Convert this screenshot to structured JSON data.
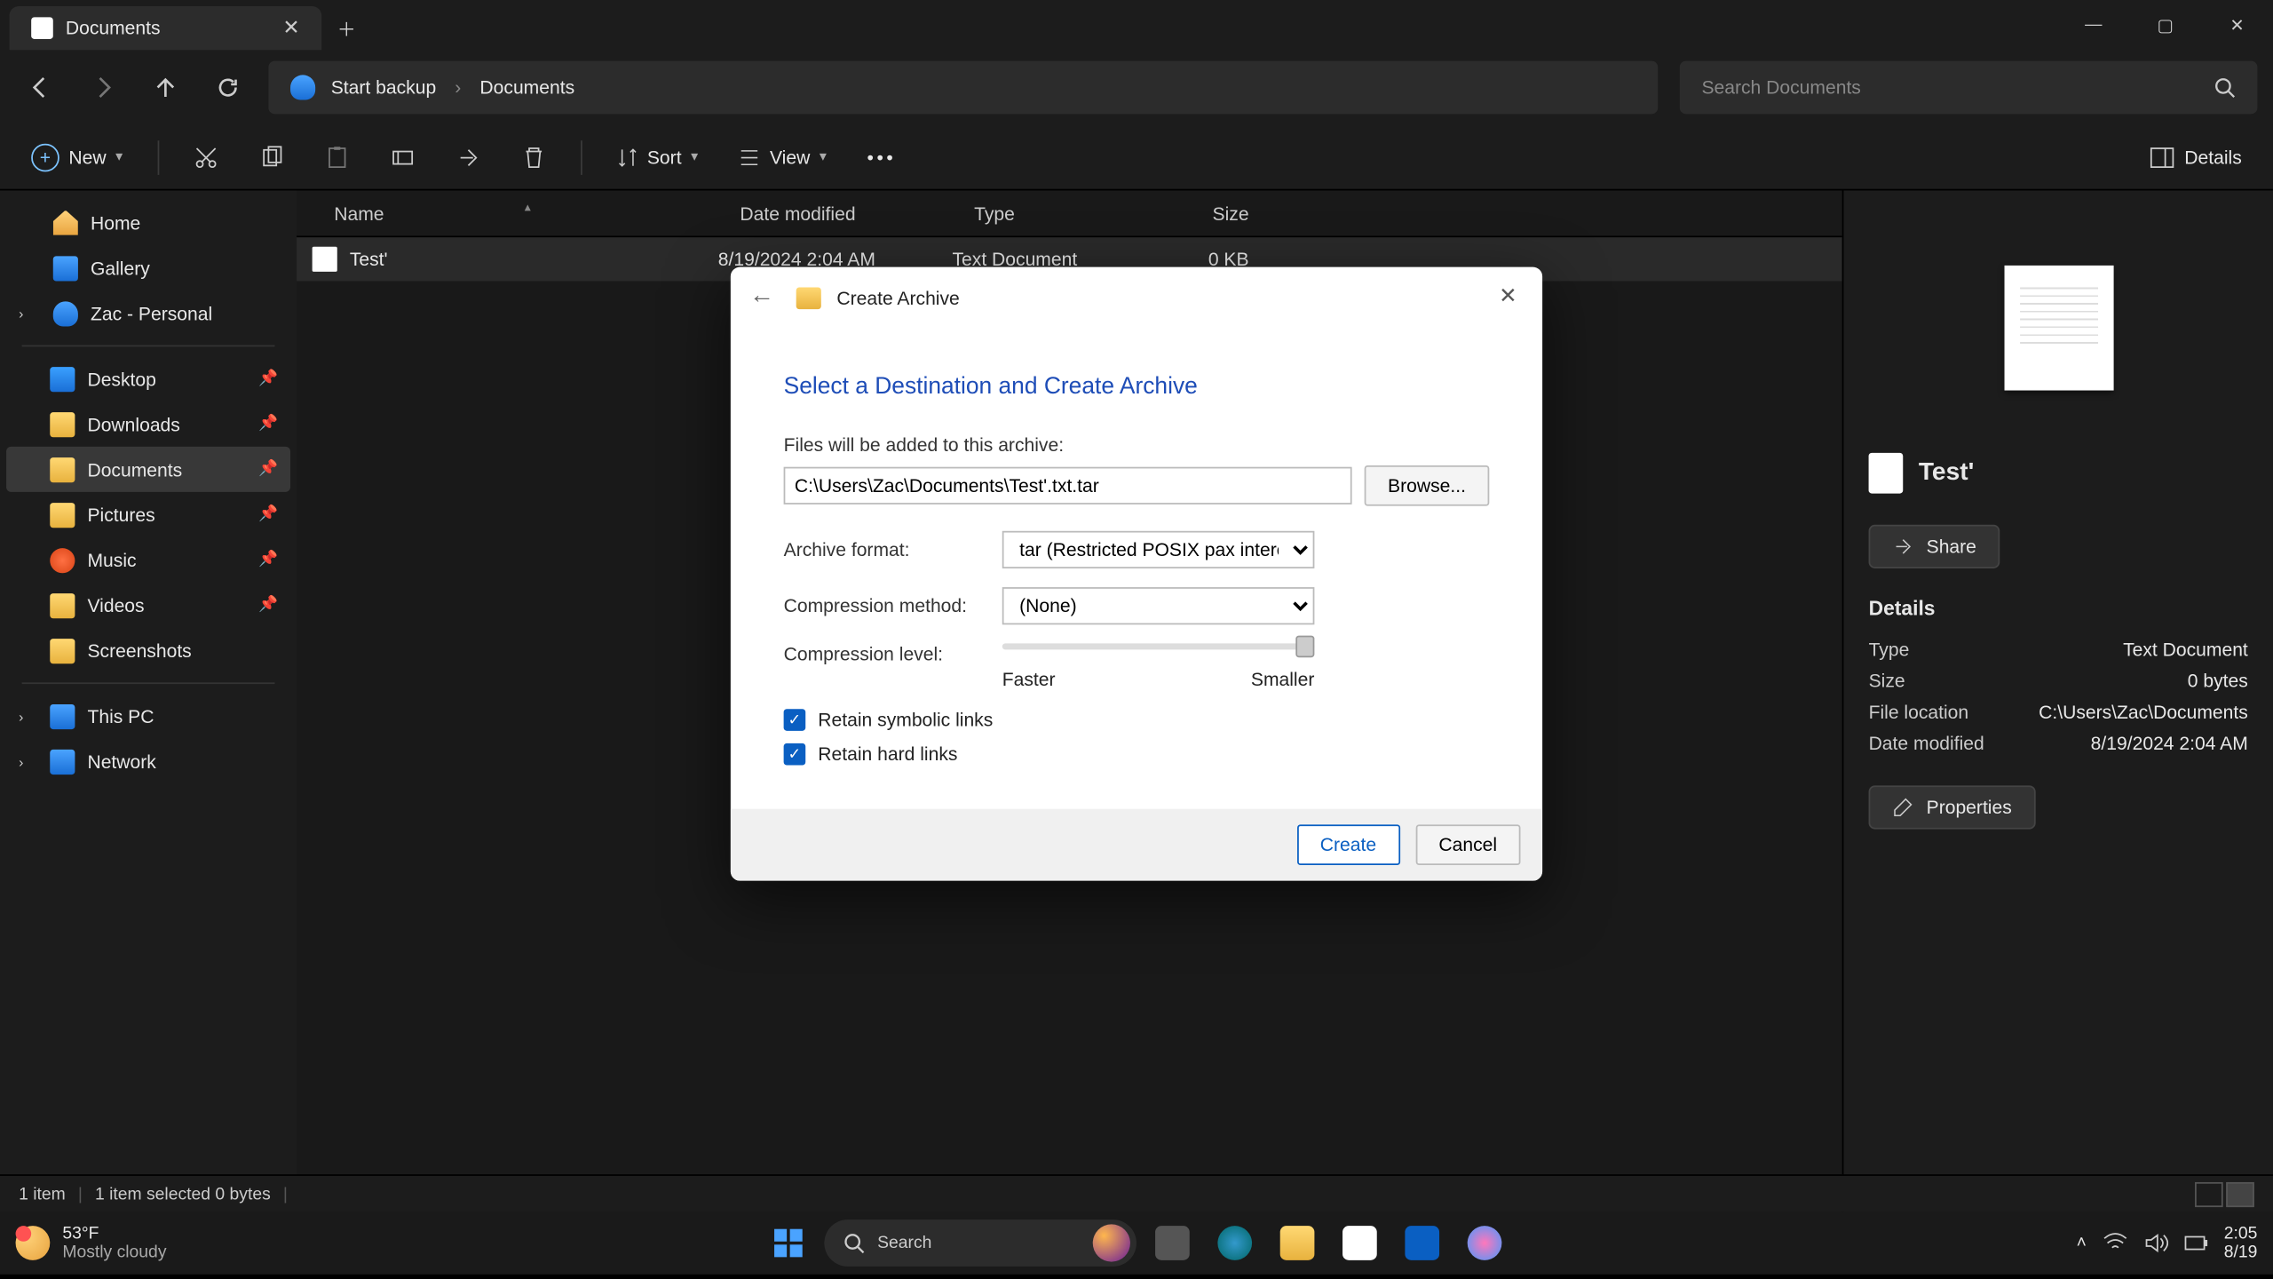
{
  "window": {
    "tab_title": "Documents",
    "minimize": "—",
    "maximize": "▢",
    "close": "✕"
  },
  "nav": {
    "back": "←",
    "forward": "→",
    "up": "↑",
    "refresh": "⟳"
  },
  "breadcrumb": {
    "root_icon_label": "Start backup",
    "location": "Documents",
    "chevron": "›"
  },
  "search": {
    "placeholder": "Search Documents"
  },
  "toolbar": {
    "new_label": "New",
    "sort_label": "Sort",
    "view_label": "View",
    "details_label": "Details"
  },
  "sidebar": {
    "items": [
      {
        "label": "Home",
        "icon": "ico-home",
        "caret": false,
        "pin": false
      },
      {
        "label": "Gallery",
        "icon": "ico-gallery",
        "caret": false,
        "pin": false
      },
      {
        "label": "Zac - Personal",
        "icon": "ico-onedrive",
        "caret": true,
        "pin": false
      }
    ],
    "quick": [
      {
        "label": "Desktop",
        "icon": "ico-desktop",
        "pin": true
      },
      {
        "label": "Downloads",
        "icon": "ico-folder",
        "pin": true
      },
      {
        "label": "Documents",
        "icon": "ico-folder",
        "pin": true,
        "selected": true
      },
      {
        "label": "Pictures",
        "icon": "ico-folder",
        "pin": true
      },
      {
        "label": "Music",
        "icon": "ico-music",
        "pin": true
      },
      {
        "label": "Videos",
        "icon": "ico-folder",
        "pin": true
      },
      {
        "label": "Screenshots",
        "icon": "ico-folder",
        "pin": false
      }
    ],
    "bottom": [
      {
        "label": "This PC",
        "icon": "ico-pc",
        "caret": true
      },
      {
        "label": "Network",
        "icon": "ico-net",
        "caret": true
      }
    ]
  },
  "columns": {
    "name": "Name",
    "date": "Date modified",
    "type": "Type",
    "size": "Size"
  },
  "files": [
    {
      "name": "Test'",
      "date": "8/19/2024 2:04 AM",
      "type": "Text Document",
      "size": "0 KB"
    }
  ],
  "details_pane": {
    "filename": "Test'",
    "share": "Share",
    "header": "Details",
    "rows": {
      "type_k": "Type",
      "type_v": "Text Document",
      "size_k": "Size",
      "size_v": "0 bytes",
      "loc_k": "File location",
      "loc_v": "C:\\Users\\Zac\\Documents",
      "mod_k": "Date modified",
      "mod_v": "8/19/2024 2:04 AM"
    },
    "properties": "Properties"
  },
  "statusbar": {
    "count": "1 item",
    "selection": "1 item selected  0 bytes"
  },
  "dialog": {
    "small_title": "Create Archive",
    "heading": "Select a Destination and Create Archive",
    "files_label": "Files will be added to this archive:",
    "path": "C:\\Users\\Zac\\Documents\\Test'.txt.tar",
    "browse": "Browse...",
    "format_label": "Archive format:",
    "format_value": "tar (Restricted POSIX pax interchange",
    "method_label": "Compression method:",
    "method_value": "(None)",
    "level_label": "Compression level:",
    "level_faster": "Faster",
    "level_smaller": "Smaller",
    "retain_sym": "Retain symbolic links",
    "retain_hard": "Retain hard links",
    "create": "Create",
    "cancel": "Cancel"
  },
  "taskbar": {
    "temp": "53°F",
    "weather": "Mostly cloudy",
    "search_placeholder": "Search",
    "time": "2:05",
    "date": "8/19"
  }
}
